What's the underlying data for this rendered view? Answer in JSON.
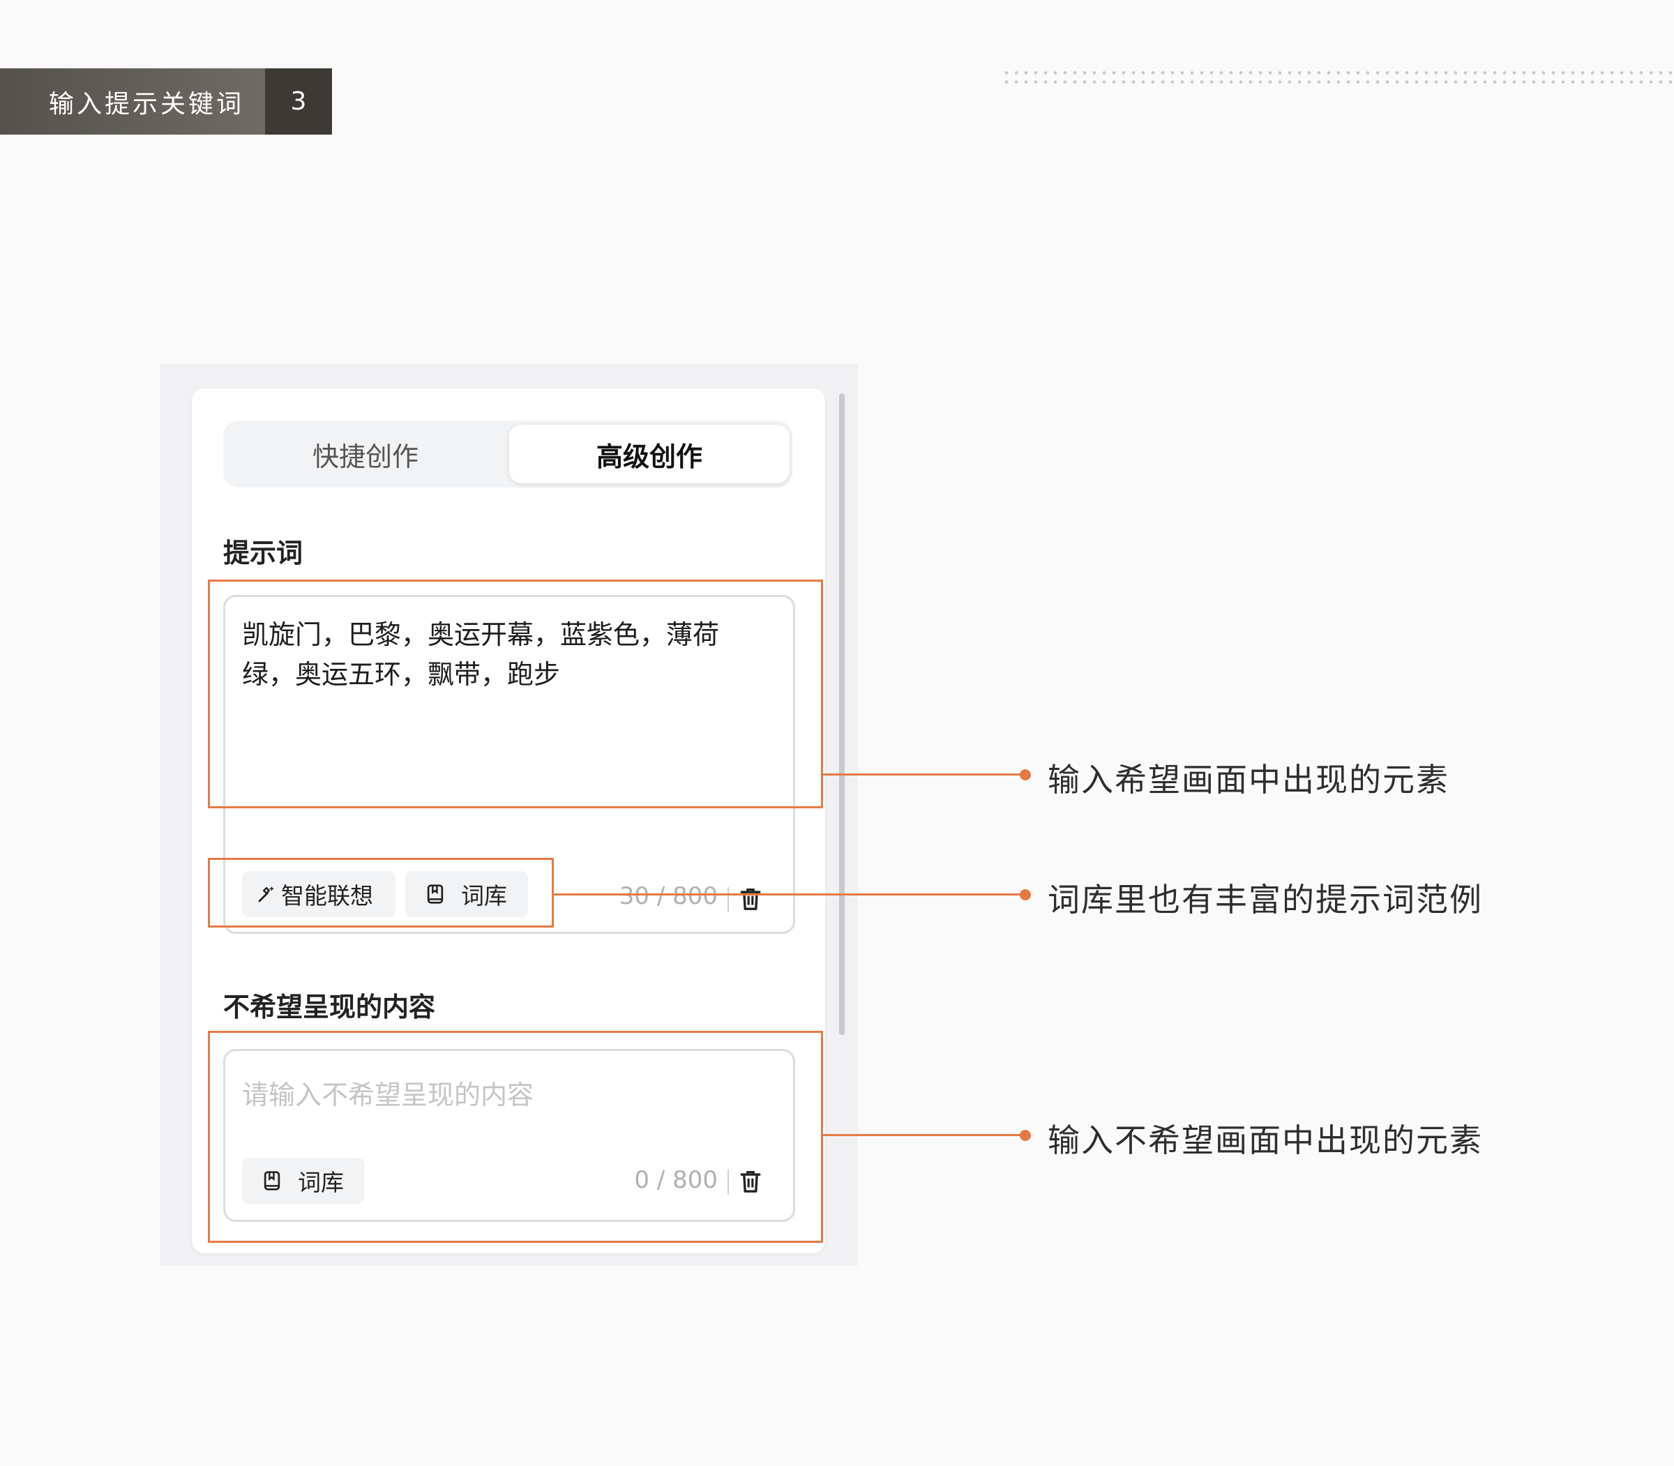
{
  "header": {
    "title": "输入提示关键词",
    "step": "3"
  },
  "tabs": [
    {
      "label": "快捷创作",
      "active": false
    },
    {
      "label": "高级创作",
      "active": true
    }
  ],
  "prompt": {
    "title": "提示词",
    "value": "凯旋门，巴黎，奥运开幕，蓝紫色，薄荷绿，奥运五环，飘带，跑步",
    "smart_label": "智能联想",
    "library_label": "词库",
    "counter": "30 / 800"
  },
  "negative": {
    "title": "不希望呈现的内容",
    "placeholder": "请输入不希望呈现的内容",
    "library_label": "词库",
    "counter": "0 / 800"
  },
  "annotations": [
    "输入希望画面中出现的元素",
    "词库里也有丰富的提示词范例",
    "输入不希望画面中出现的元素"
  ],
  "colors": {
    "accent": "#e57a44",
    "header_bg": "#55514c",
    "header_num_bg": "#3d3a36"
  }
}
